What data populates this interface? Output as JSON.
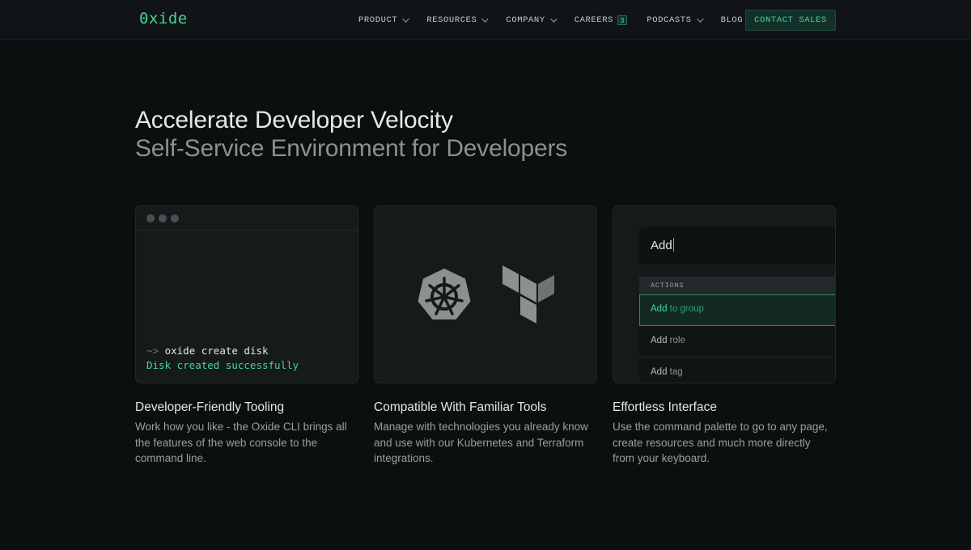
{
  "nav": {
    "logo": "0xide",
    "items": [
      {
        "label": "PRODUCT",
        "dropdown": true
      },
      {
        "label": "RESOURCES",
        "dropdown": true
      },
      {
        "label": "COMPANY",
        "dropdown": true
      },
      {
        "label": "CAREERS",
        "badge": "3"
      },
      {
        "label": "PODCASTS",
        "dropdown": true
      },
      {
        "label": "BLOG"
      }
    ],
    "cta": "CONTACT SALES"
  },
  "hero": {
    "title": "Accelerate Developer Velocity",
    "subtitle": "Self-Service Environment for Developers"
  },
  "terminal": {
    "prompt": "~>",
    "command": "oxide create disk",
    "output": "Disk created successfully"
  },
  "tools_icons": [
    "kubernetes-icon",
    "terraform-icon"
  ],
  "palette": {
    "query": "Add",
    "section": "ACTIONS",
    "items": [
      {
        "match": "Add",
        "rest": " to group"
      },
      {
        "match": "Add",
        "rest": " role"
      },
      {
        "match": "Add",
        "rest": " tag"
      }
    ]
  },
  "features": [
    {
      "title": "Developer-Friendly Tooling",
      "desc": "Work how you like - the Oxide CLI brings all the features of the web console to the command line."
    },
    {
      "title": "Compatible With Familiar Tools",
      "desc": "Manage with technologies you already know and use with our Kubernetes and Terraform integrations."
    },
    {
      "title": "Effortless Interface",
      "desc": "Use the command palette to go to any page, create resources and much more directly from your keyboard."
    }
  ],
  "colors": {
    "accent": "#48d597",
    "background": "#0a0f10",
    "card": "#151a1b"
  }
}
